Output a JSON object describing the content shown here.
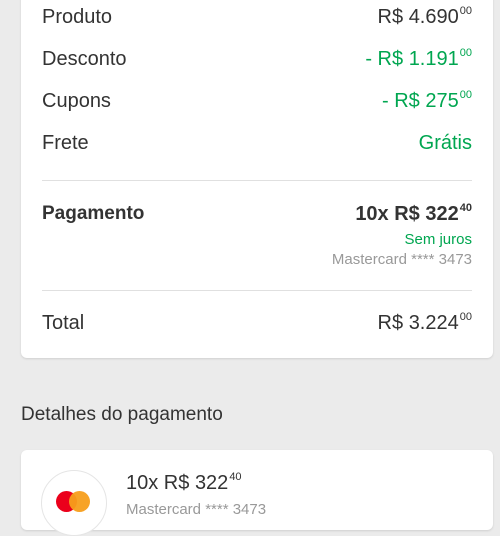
{
  "summary": {
    "produto": {
      "label": "Produto",
      "currency": "R$",
      "amount": "4.690",
      "cents": "00"
    },
    "desconto": {
      "label": "Desconto",
      "prefix": "- R$",
      "amount": "1.191",
      "cents": "00"
    },
    "cupons": {
      "label": "Cupons",
      "prefix": "- R$",
      "amount": "275",
      "cents": "00"
    },
    "frete": {
      "label": "Frete",
      "value": "Grátis"
    },
    "pagamento": {
      "label": "Pagamento",
      "installments": "10x R$",
      "amount": "322",
      "cents": "40",
      "interest": "Sem juros",
      "card": "Mastercard **** 3473"
    },
    "total": {
      "label": "Total",
      "currency": "R$",
      "amount": "3.224",
      "cents": "00"
    }
  },
  "details": {
    "title": "Detalhes do pagamento",
    "installments": "10x R$",
    "amount": "322",
    "cents": "40",
    "card": "Mastercard **** 3473"
  },
  "colors": {
    "green": "#00a650",
    "mastercard_red": "#eb001b",
    "mastercard_yellow": "#f79e1b"
  }
}
